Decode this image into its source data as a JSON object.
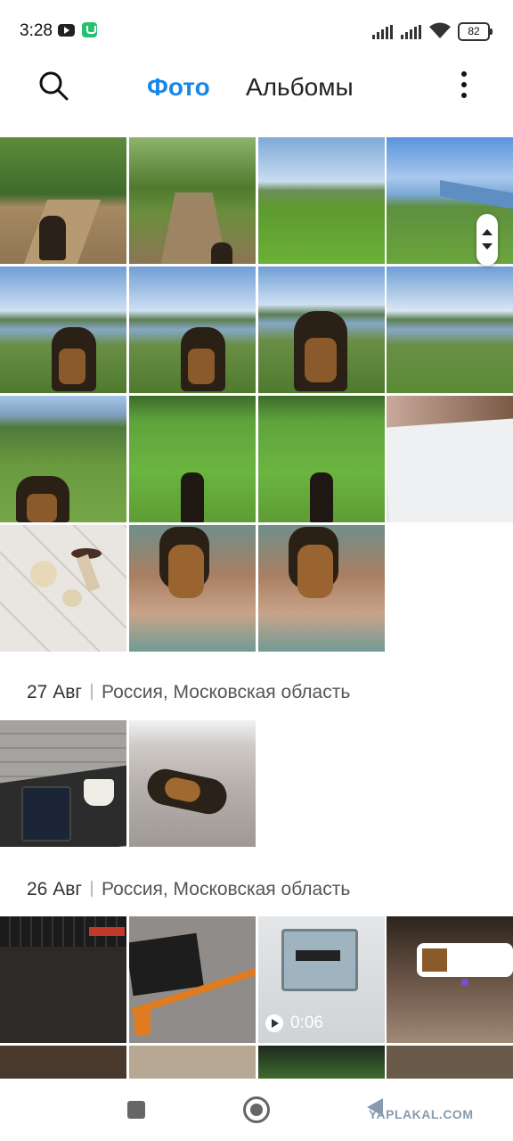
{
  "status": {
    "time": "3:28",
    "battery": "82"
  },
  "tabs": {
    "photo": "Фото",
    "albums": "Альбомы"
  },
  "sections": [
    {
      "date": "27 Авг",
      "location": "Россия, Московская область"
    },
    {
      "date": "26 Авг",
      "location": "Россия, Московская область"
    }
  ],
  "video": {
    "duration": "0:06"
  },
  "watermark": "YAPLAKAL.COM",
  "colors": {
    "accent": "#1a86e6"
  }
}
